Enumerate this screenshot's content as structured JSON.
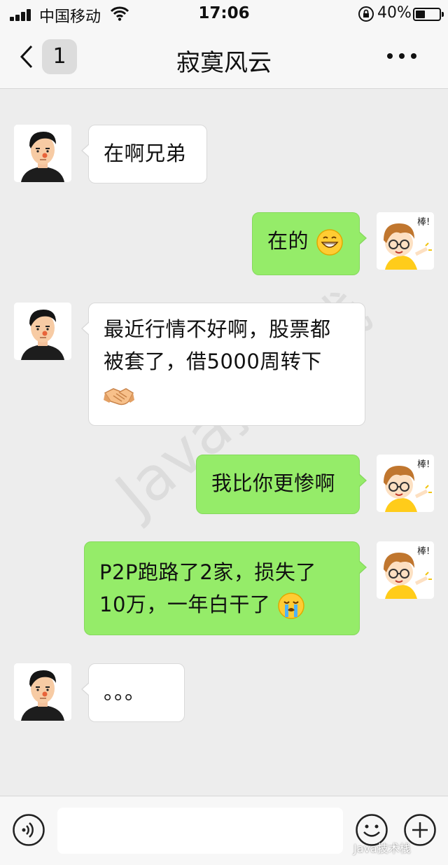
{
  "status_bar": {
    "carrier": "中国移动",
    "time": "17:06",
    "battery_percent": "40%",
    "battery_level": 0.4
  },
  "nav": {
    "unread_count": "1",
    "title": "寂寞风云"
  },
  "messages": [
    {
      "side": "incoming",
      "text": "在啊兄弟"
    },
    {
      "side": "outgoing",
      "text": "在的",
      "emoji": "grinning-face-emoji"
    },
    {
      "side": "incoming",
      "line1": "最近行情不好啊，股票都",
      "line2": "被套了，借5000周转下",
      "emoji": "handshake-emoji"
    },
    {
      "side": "outgoing",
      "text": "我比你更惨啊"
    },
    {
      "side": "outgoing",
      "line1": "P2P跑路了2家，损失了",
      "line2": "10万，一年白干了",
      "emoji": "crying-face-emoji"
    },
    {
      "side": "incoming",
      "text": "。。。"
    }
  ],
  "sticker_text": "棒!",
  "watermark": "Java技术栈",
  "source_credit": "Java技术栈",
  "colors": {
    "outgoing_bubble": "#95ec69",
    "incoming_bubble": "#ffffff",
    "background": "#ededed"
  }
}
